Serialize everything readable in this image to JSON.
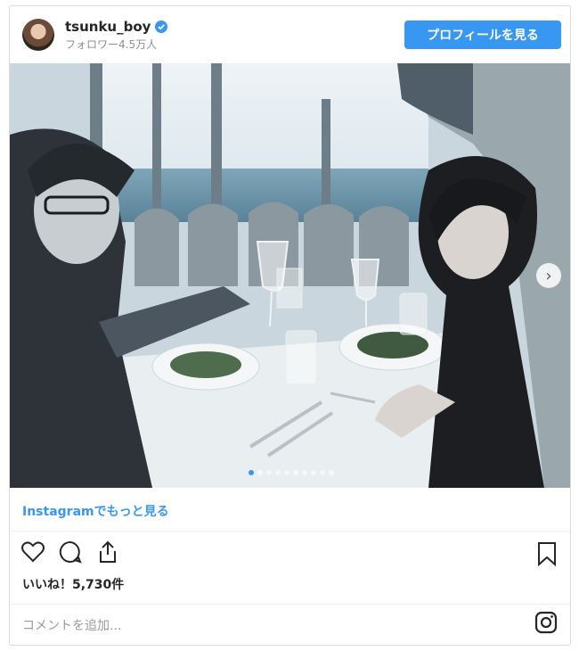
{
  "post": {
    "username": "tsunku_boy",
    "followers": "フォロワー4.5万人",
    "profile_button": "プロフィールを見る",
    "more_link": "Instagramでもっと見る",
    "likes": "いいね！5,730件",
    "comment_placeholder": "コメントを追加...",
    "carousel": {
      "total_slides": 10,
      "active_index": 0
    }
  },
  "icons": [
    "verified-icon",
    "heart-icon",
    "comment-icon",
    "share-icon",
    "bookmark-icon",
    "instagram-icon",
    "chevron-right-icon"
  ],
  "colors": {
    "accent": "#3897f0",
    "text": "#262626",
    "muted": "#8e8e8e",
    "border": "#dbdbdb"
  }
}
